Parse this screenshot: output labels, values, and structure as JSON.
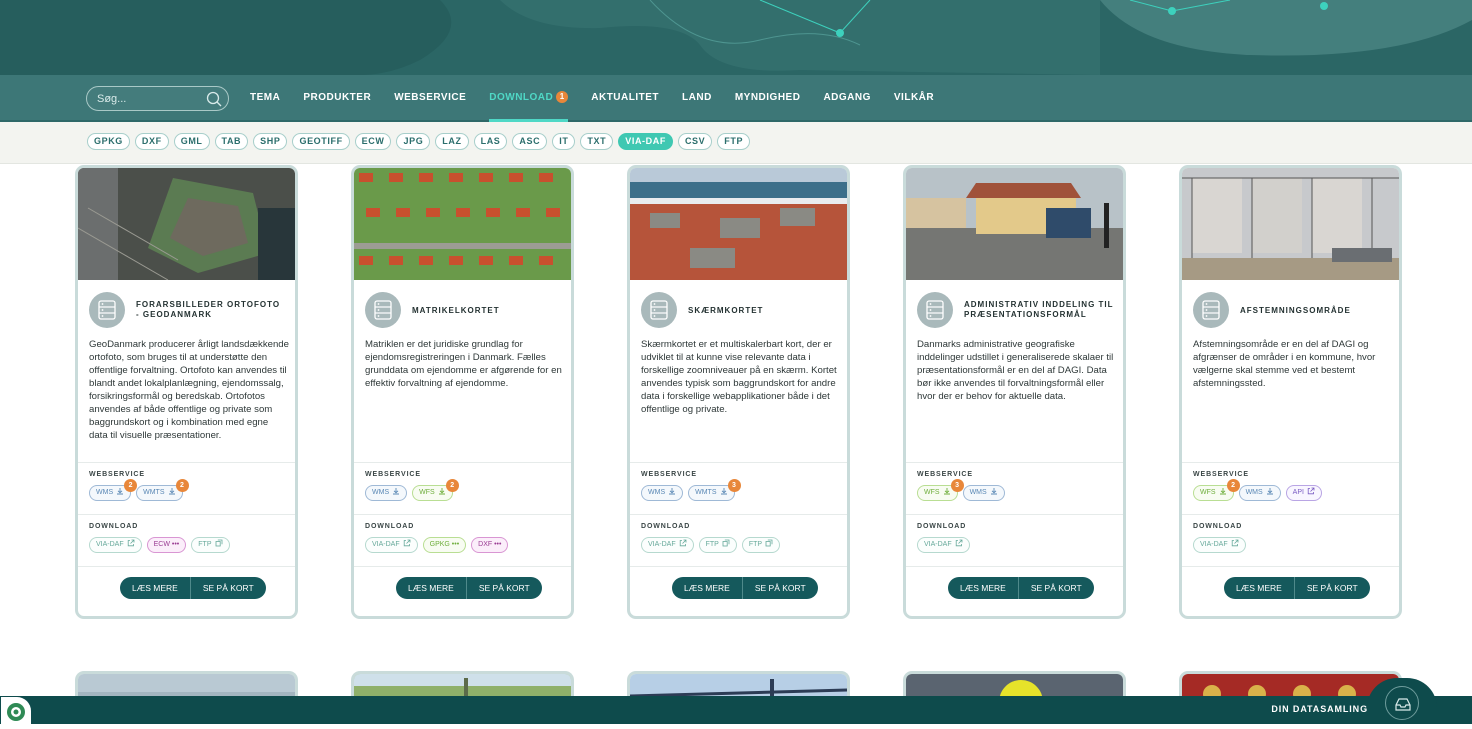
{
  "search": {
    "placeholder": "Søg..."
  },
  "nav": {
    "items": [
      {
        "label": "TEMA"
      },
      {
        "label": "PRODUKTER"
      },
      {
        "label": "WEBSERVICE"
      },
      {
        "label": "DOWNLOAD",
        "badge": "1",
        "active": true
      },
      {
        "label": "AKTUALITET"
      },
      {
        "label": "LAND"
      },
      {
        "label": "MYNDIGHED"
      },
      {
        "label": "ADGANG"
      },
      {
        "label": "VILKÅR"
      }
    ]
  },
  "formats": [
    "GPKG",
    "DXF",
    "GML",
    "TAB",
    "SHP",
    "GEOTIFF",
    "ECW",
    "JPG",
    "LAZ",
    "LAS",
    "ASC",
    "IT",
    "TXT",
    "VIA-DAF",
    "CSV",
    "FTP"
  ],
  "active_format": "VIA-DAF",
  "section_labels": {
    "webservice": "WEBSERVICE",
    "download": "DOWNLOAD"
  },
  "buttons": {
    "read_more": "LÆS MERE",
    "see_on_map": "SE PÅ KORT"
  },
  "cards": [
    {
      "title": "FORARSBILLEDER ORTOFOTO - GEODANMARK",
      "description": "GeoDanmark producerer årligt landsdækkende ortofoto, som bruges til at understøtte den offentlige forvaltning. Ortofoto kan anvendes til blandt andet lokalplanlægning, ejendomssalg, forsikringsformål og beredskab. Ortofotos anvendes af både offentlige og private som baggrundskort og i kombination med egne data til visuelle præsentationer.",
      "webservice": [
        {
          "label": "WMS",
          "count": "2"
        },
        {
          "label": "WMTS",
          "count": "2"
        }
      ],
      "download": [
        {
          "label": "VIA-DAF"
        },
        {
          "label": "ECW •••"
        },
        {
          "label": "FTP"
        }
      ]
    },
    {
      "title": "MATRIKELKORTET",
      "description": "Matriklen er det juridiske grundlag for ejendomsregistreringen i Danmark. Fælles grunddata om ejendomme er afgørende for en effektiv forvaltning af ejendomme.",
      "webservice": [
        {
          "label": "WMS"
        },
        {
          "label": "WFS",
          "count": "2"
        }
      ],
      "download": [
        {
          "label": "VIA-DAF"
        },
        {
          "label": "GPKG •••"
        },
        {
          "label": "DXF •••"
        }
      ]
    },
    {
      "title": "SKÆRMKORTET",
      "description": "Skærmkortet er et multiskalerbart kort, der er udviklet til at kunne vise relevante data i forskellige zoomniveauer på en skærm. Kortet anvendes typisk som baggrundskort for andre data i forskellige webapplikationer både i det offentlige og private.",
      "webservice": [
        {
          "label": "WMS"
        },
        {
          "label": "WMTS",
          "count": "3"
        }
      ],
      "download": [
        {
          "label": "VIA-DAF"
        },
        {
          "label": "FTP"
        },
        {
          "label": "FTP"
        }
      ]
    },
    {
      "title": "ADMINISTRATIV INDDELING TIL PRÆSENTATIONSFORMÅL",
      "description": "Danmarks administrative geografiske inddelinger udstillet i generaliserede skalaer til præsentationsformål er en del af DAGI. Data bør ikke anvendes til forvaltningsformål eller hvor der er behov for aktuelle data.",
      "webservice": [
        {
          "label": "WFS",
          "count": "3"
        },
        {
          "label": "WMS"
        }
      ],
      "download": [
        {
          "label": "VIA-DAF"
        }
      ]
    },
    {
      "title": "AFSTEMNINGSOMRÅDE",
      "description": "Afstemningsområde er en del af DAGI og afgrænser de områder i en kommune, hvor vælgerne skal stemme ved et bestemt afstemningssted.",
      "webservice": [
        {
          "label": "WFS",
          "count": "2"
        },
        {
          "label": "WMS"
        },
        {
          "label": "API"
        }
      ],
      "download": [
        {
          "label": "VIA-DAF"
        }
      ]
    }
  ],
  "footer": {
    "label": "DIN DATASAMLING"
  }
}
